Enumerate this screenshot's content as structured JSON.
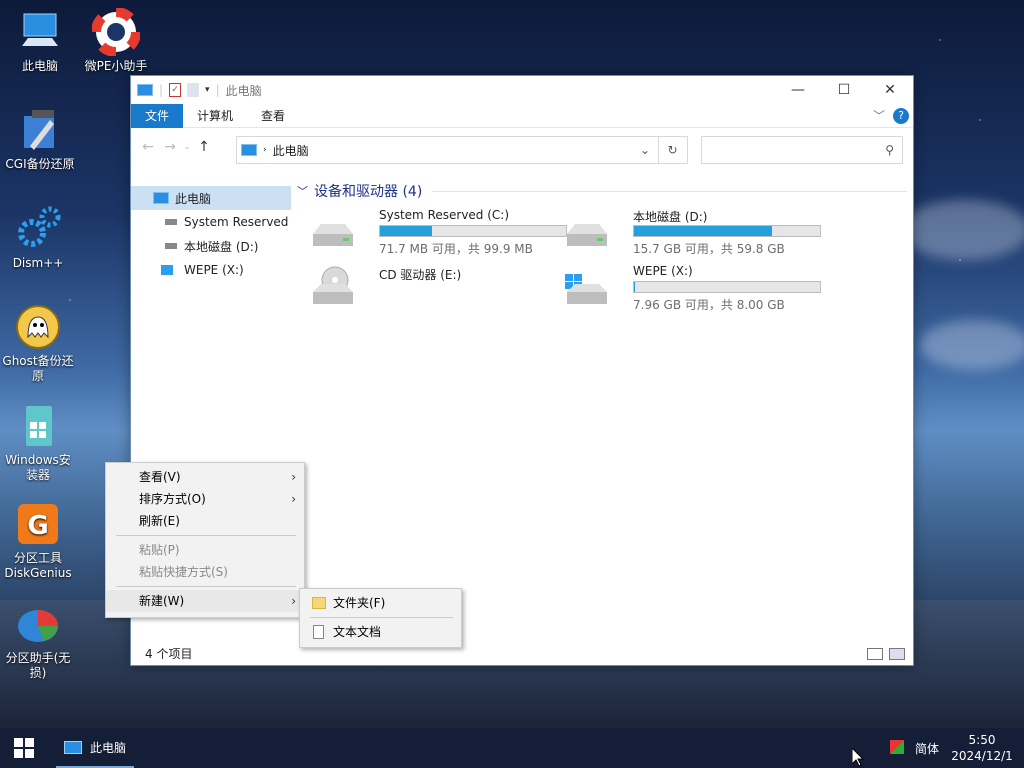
{
  "desktop": {
    "icons": [
      {
        "label": "此电脑",
        "icon": "computer-icon"
      },
      {
        "label": "微PE小助手",
        "icon": "lifebuoy-icon"
      },
      {
        "label": "CGI备份还原",
        "icon": "cgi-tool-icon"
      },
      {
        "label": "Dism++",
        "icon": "gears-icon"
      },
      {
        "label": "Ghost备份还原",
        "icon": "ghost-icon"
      },
      {
        "label": "Windows安装器",
        "icon": "windows-installer-icon"
      },
      {
        "label": "分区工具DiskGenius",
        "icon": "diskgenius-icon"
      },
      {
        "label": "分区助手(无损)",
        "icon": "partition-assistant-icon"
      }
    ]
  },
  "window": {
    "title": "此电脑",
    "ribbon_tabs": [
      "文件",
      "计算机",
      "查看"
    ],
    "address": "此电脑",
    "nav_pane": [
      {
        "label": "此电脑"
      },
      {
        "label": "System Reserved"
      },
      {
        "label": "本地磁盘 (D:)"
      },
      {
        "label": "WEPE (X:)"
      }
    ],
    "group_title": "设备和驱动器 (4)",
    "drives": [
      {
        "name": "System Reserved (C:)",
        "space": "71.7 MB 可用，共 99.9 MB",
        "used_fraction": 0.28,
        "icon": "hard-drive-icon"
      },
      {
        "name": "本地磁盘 (D:)",
        "space": "15.7 GB 可用，共 59.8 GB",
        "used_fraction": 0.74,
        "icon": "hard-drive-icon"
      },
      {
        "name": "CD 驱动器 (E:)",
        "space": "",
        "icon": "cd-drive-icon"
      },
      {
        "name": "WEPE (X:)",
        "space": "7.96 GB 可用，共 8.00 GB",
        "used_fraction": 0.005,
        "icon": "windows-drive-icon"
      }
    ],
    "status": "4 个项目"
  },
  "context_menu": {
    "items": [
      {
        "label": "查看(V)",
        "submenu": true,
        "enabled": true
      },
      {
        "label": "排序方式(O)",
        "submenu": true,
        "enabled": true
      },
      {
        "label": "刷新(E)",
        "submenu": false,
        "enabled": true
      },
      {
        "label": "粘贴(P)",
        "submenu": false,
        "enabled": false
      },
      {
        "label": "粘贴快捷方式(S)",
        "submenu": false,
        "enabled": false
      },
      {
        "label": "新建(W)",
        "submenu": true,
        "enabled": true
      }
    ],
    "submenu": [
      {
        "label": "文件夹(F)",
        "icon": "folder-icon"
      },
      {
        "label": "文本文档",
        "icon": "text-document-icon"
      }
    ]
  },
  "taskbar": {
    "task_label": "此电脑",
    "ime": "简体",
    "time": "5:50",
    "date": "2024/12/1"
  },
  "colors": {
    "accent": "#1979ca",
    "bar_fill": "#26a0da",
    "group_title": "#1e3287"
  }
}
